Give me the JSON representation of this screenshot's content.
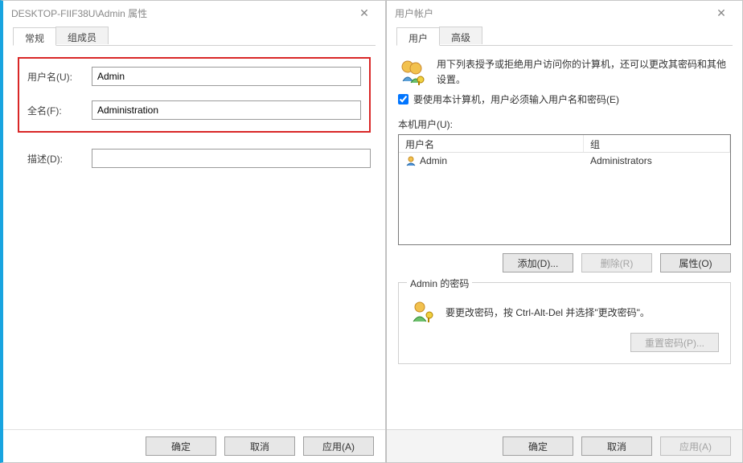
{
  "left": {
    "title": "DESKTOP-FIIF38U\\Admin 属性",
    "tabs": {
      "general": "常规",
      "members": "组成员"
    },
    "fields": {
      "username_label": "用户名(U):",
      "username_value": "Admin",
      "fullname_label": "全名(F):",
      "fullname_value": "Administration",
      "desc_label": "描述(D):",
      "desc_value": ""
    },
    "buttons": {
      "ok": "确定",
      "cancel": "取消",
      "apply": "应用(A)"
    }
  },
  "right": {
    "title": "用户帐户",
    "tabs": {
      "users": "用户",
      "advanced": "高级"
    },
    "intro": "用下列表授予或拒绝用户访问你的计算机，还可以更改其密码和其他设置。",
    "checkbox_label": "要使用本计算机，用户必须输入用户名和密码(E)",
    "checkbox_checked": true,
    "list_label": "本机用户(U):",
    "columns": {
      "user": "用户名",
      "group": "组"
    },
    "rows": [
      {
        "user": "Admin",
        "group": "Administrators"
      }
    ],
    "list_buttons": {
      "add": "添加(D)...",
      "remove": "删除(R)",
      "props": "属性(O)"
    },
    "password_group": {
      "legend": "Admin 的密码",
      "text": "要更改密码，按 Ctrl-Alt-Del 并选择\"更改密码\"。",
      "reset": "重置密码(P)..."
    },
    "buttons": {
      "ok": "确定",
      "cancel": "取消",
      "apply": "应用(A)"
    }
  }
}
